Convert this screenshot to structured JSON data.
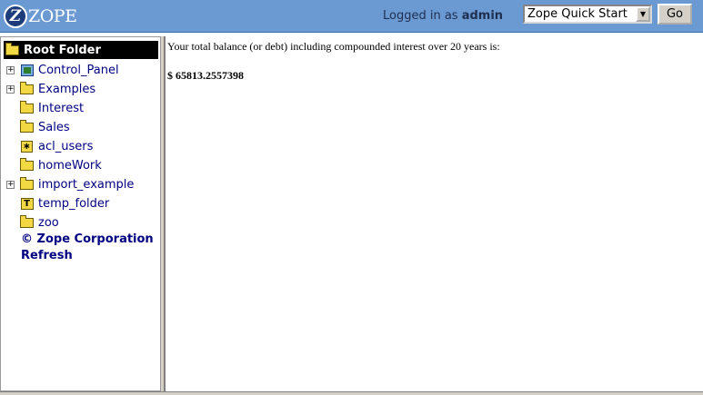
{
  "header": {
    "logo_text": "ZOPE",
    "logged_in_prefix": "Logged in as",
    "username": "admin",
    "quick_start_selected": "Zope Quick Start",
    "go_label": "Go"
  },
  "tree": {
    "root_label": "Root Folder",
    "items": [
      {
        "label": "Control_Panel",
        "icon": "control-panel-icon",
        "expandable": true
      },
      {
        "label": "Examples",
        "icon": "folder-icon",
        "expandable": true
      },
      {
        "label": "Interest",
        "icon": "folder-icon",
        "expandable": false
      },
      {
        "label": "Sales",
        "icon": "folder-icon",
        "expandable": false
      },
      {
        "label": "acl_users",
        "icon": "user-folder-icon",
        "expandable": false
      },
      {
        "label": "homeWork",
        "icon": "folder-icon",
        "expandable": false
      },
      {
        "label": "import_example",
        "icon": "folder-icon",
        "expandable": true
      },
      {
        "label": "temp_folder",
        "icon": "temp-folder-icon",
        "expandable": false
      },
      {
        "label": "zoo",
        "icon": "folder-icon",
        "expandable": false
      }
    ],
    "copyright": "© Zope Corporation",
    "refresh": "Refresh"
  },
  "main": {
    "result_text": "Your total balance (or debt) including compounded interest over 20 years is:",
    "result_value": "$ 65813.2557398"
  }
}
